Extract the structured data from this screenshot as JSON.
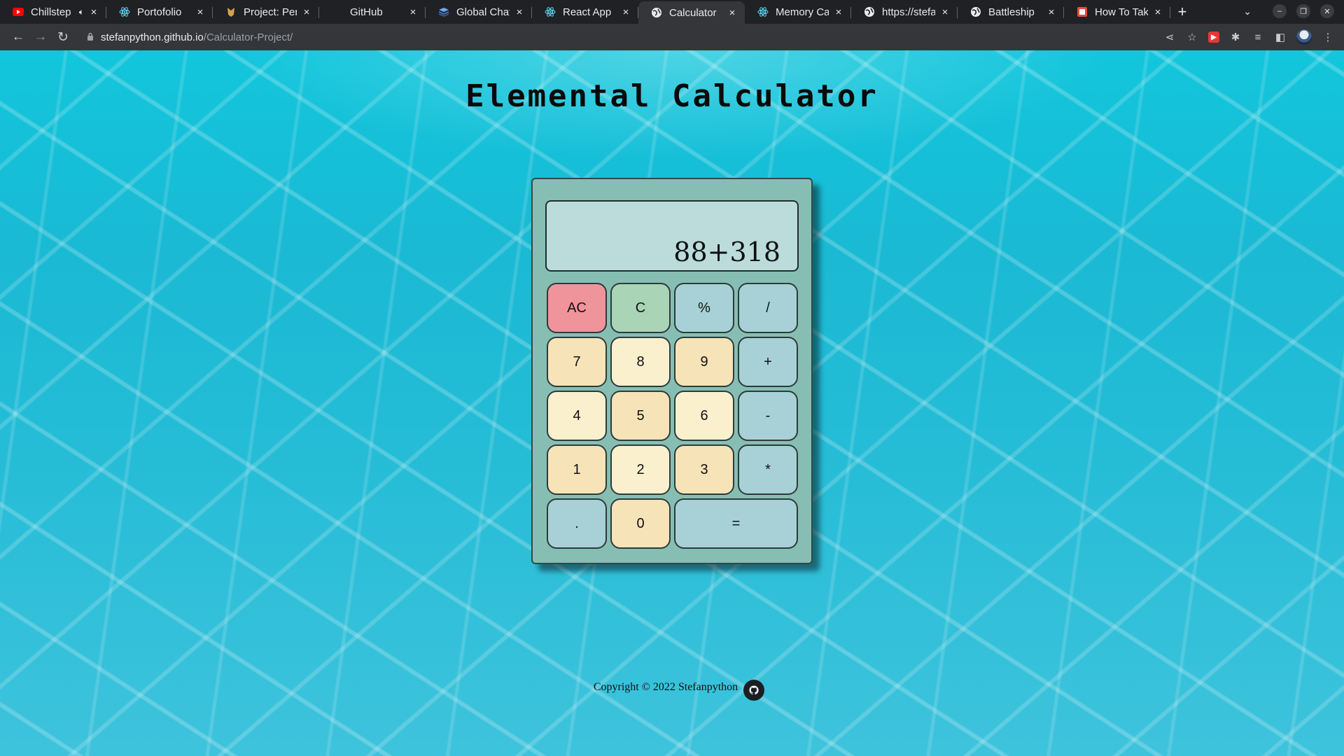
{
  "browser": {
    "tabs": [
      {
        "title": "Chillstep",
        "favicon": "youtube-icon",
        "audio": true
      },
      {
        "title": "Portofolio",
        "favicon": "react-icon"
      },
      {
        "title": "Project: Pers",
        "favicon": "odin-icon"
      },
      {
        "title": "GitHub",
        "favicon": "github-icon"
      },
      {
        "title": "Global Chat",
        "favicon": "stack-icon"
      },
      {
        "title": "React App",
        "favicon": "react-icon"
      },
      {
        "title": "Calculator",
        "favicon": "globe-icon",
        "active": true
      },
      {
        "title": "Memory Carc",
        "favicon": "react-icon"
      },
      {
        "title": "https://stefa",
        "favicon": "globe-icon"
      },
      {
        "title": "Battleship",
        "favicon": "globe-icon"
      },
      {
        "title": "How To Take",
        "favicon": "article-icon"
      }
    ],
    "url_host": "stefanpython.github.io",
    "url_path": "/Calculator-Project/"
  },
  "page": {
    "title": "Elemental Calculator",
    "footer": "Copyright © 2022 Stefanpython"
  },
  "calculator": {
    "display": "88+318",
    "keys": [
      {
        "label": "AC",
        "color": "#f0949b"
      },
      {
        "label": "C",
        "color": "#a9d4b5"
      },
      {
        "label": "%",
        "color": "#a7d1d6"
      },
      {
        "label": "/",
        "color": "#a7d1d6"
      },
      {
        "label": "7",
        "color": "#f6e3b8"
      },
      {
        "label": "8",
        "color": "#faf0ce"
      },
      {
        "label": "9",
        "color": "#f6e3b8"
      },
      {
        "label": "+",
        "color": "#a7d1d6"
      },
      {
        "label": "4",
        "color": "#faf0ce"
      },
      {
        "label": "5",
        "color": "#f6e3b8"
      },
      {
        "label": "6",
        "color": "#faf0ce"
      },
      {
        "label": "-",
        "color": "#a7d1d6"
      },
      {
        "label": "1",
        "color": "#f6e3b8"
      },
      {
        "label": "2",
        "color": "#faf0ce"
      },
      {
        "label": "3",
        "color": "#f6e3b8"
      },
      {
        "label": "*",
        "color": "#a7d1d6"
      },
      {
        "label": ".",
        "color": "#a7d1d6"
      },
      {
        "label": "0",
        "color": "#f6e3b8"
      },
      {
        "label": "=",
        "color": "#a7d1d6"
      }
    ]
  }
}
